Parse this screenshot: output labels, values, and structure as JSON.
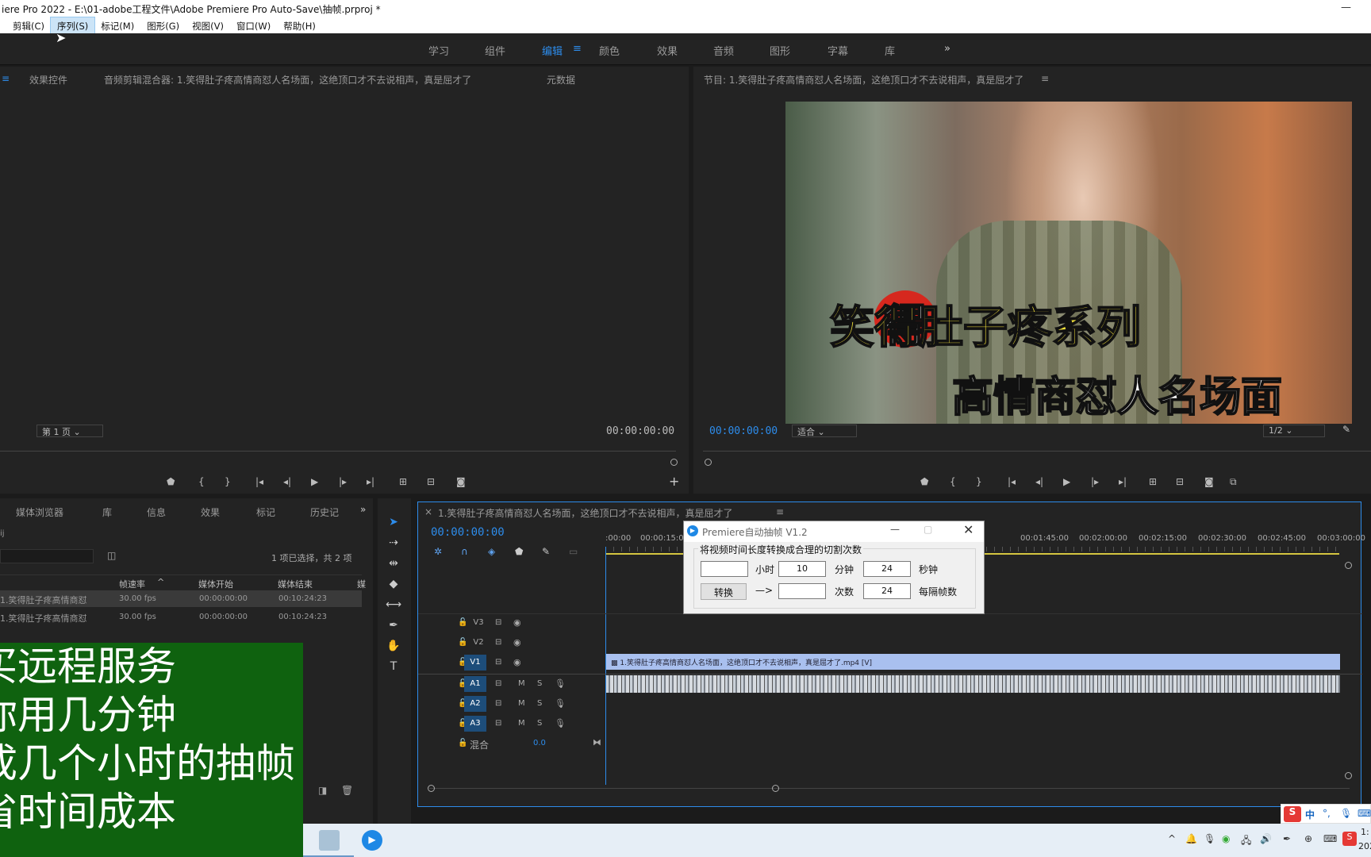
{
  "window_title": "iere Pro 2022 - E:\\01-adobe工程文件\\Adobe Premiere Pro Auto-Save\\抽帧.prproj *",
  "menu": [
    "剪辑(C)",
    "序列(S)",
    "标记(M)",
    "图形(G)",
    "视图(V)",
    "窗口(W)",
    "帮助(H)"
  ],
  "workspaces": [
    "学习",
    "组件",
    "编辑",
    "颜色",
    "效果",
    "音频",
    "图形",
    "字幕",
    "库"
  ],
  "source_panel": {
    "tabs": [
      "效果控件",
      "音频剪辑混合器: 1.笑得肚子疼高情商怼人名场面，这绝顶口才不去说相声，真是屈才了",
      "元数据"
    ],
    "page": "第 1 页",
    "timecode": "00:00:00:00"
  },
  "program_panel": {
    "title": "节目: 1.笑得肚子疼高情商怼人名场面，这绝顶口才不去说相声，真是屈才了",
    "timecode": "00:00:00:00",
    "fit": "适合",
    "res": "1/2",
    "caption1": "笑得肚子疼系列",
    "caption1_char": "得",
    "caption2": "高情商怼人名场面"
  },
  "project_panel": {
    "tabs": [
      "媒体浏览器",
      "库",
      "信息",
      "效果",
      "标记",
      "历史记"
    ],
    "label": "ij",
    "count": "1 项已选择，共 2 项",
    "columns": [
      "帧速率",
      "媒体开始",
      "媒体结束",
      "媒"
    ],
    "rows": [
      {
        "name": "1.笑得肚子疼高情商怼",
        "fps": "30.00 fps",
        "start": "00:00:00:00",
        "end": "00:10:24:23"
      },
      {
        "name": "1.笑得肚子疼高情商怼",
        "fps": "30.00 fps",
        "start": "00:00:00:00",
        "end": "00:10:24:23"
      }
    ]
  },
  "timeline": {
    "title": "1.笑得肚子疼高情商怼人名场面，这绝顶口才不去说相声，真是屈才了",
    "timecode": "00:00:00:00",
    "ruler": [
      ":00:00",
      "00:00:15:00",
      "00:01:45:00",
      "00:02:00:00",
      "00:02:15:00",
      "00:02:30:00",
      "00:02:45:00",
      "00:03:00:00"
    ],
    "video_tracks": [
      "V3",
      "V2",
      "V1"
    ],
    "audio_tracks": [
      "A1",
      "A2",
      "A3"
    ],
    "mix_label": "混合",
    "mix_value": "0.0",
    "clip": "1.笑得肚子疼高情商怼人名场面，这绝顶口才不去说相声，真是屈才了.mp4 [V]"
  },
  "dialog": {
    "title": "Premiere自动抽帧 V1.2",
    "group": "将视频时间长度转换成合理的切割次数",
    "hours": "",
    "hours_label": "小时",
    "minutes": "10",
    "minutes_label": "分钟",
    "seconds": "24",
    "seconds_label": "秒钟",
    "convert": "转换",
    "arrow": "—>",
    "result": "",
    "times_label": "次数",
    "interval": "24",
    "interval_label": "每隔帧数"
  },
  "overlay": [
    "买远程服务",
    "你用几分钟",
    "成几个小时的抽帧",
    "省时间成本"
  ],
  "tray": {
    "ime": "中",
    "time": "1:",
    "date": "202"
  }
}
